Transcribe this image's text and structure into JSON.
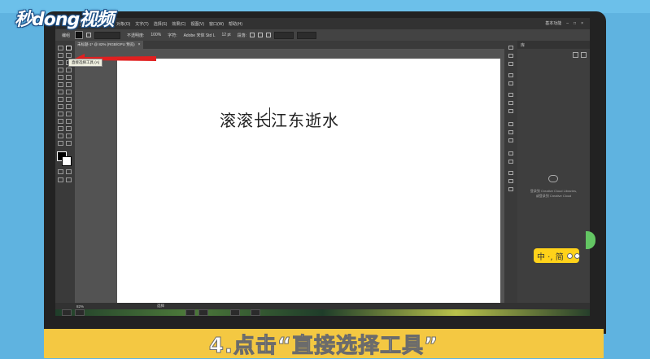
{
  "logo": {
    "text": "秒dong视频"
  },
  "window": {
    "menu": [
      "文件(F)",
      "编辑(E)",
      "对象(O)",
      "文字(T)",
      "选择(S)",
      "效果(C)",
      "视图(V)",
      "窗口(W)",
      "帮助(H)"
    ],
    "workspace": "基本功能"
  },
  "control_bar": {
    "group_label": "编组",
    "opacity_label": "不透明度:",
    "opacity_value": "100%",
    "char_label": "字符:",
    "font_value": "Adobe 宋体 Std L",
    "size_value": "12 pt",
    "paragraph_label": "段落:"
  },
  "document": {
    "tab_label": "未标题-1* @ 82% (RGB/GPU 预览)",
    "tab_close": "×",
    "artboard_text": "滚滚长江东逝水"
  },
  "tooltip": {
    "text": "直接选择工具 (A)"
  },
  "panel": {
    "tab": "库",
    "cc_line1": "登录到 Creative Cloud Libraries,",
    "cc_line2": "或登录到 Creative Cloud"
  },
  "status": {
    "zoom": "82%",
    "tool": "选择"
  },
  "ime": {
    "label": "中 ·, 简"
  },
  "caption": {
    "text": "4.点击“直接选择工具”"
  },
  "colors": {
    "accent_red": "#e02020",
    "caption_band": "#f4c842",
    "ime_bar": "#ffd21a"
  }
}
